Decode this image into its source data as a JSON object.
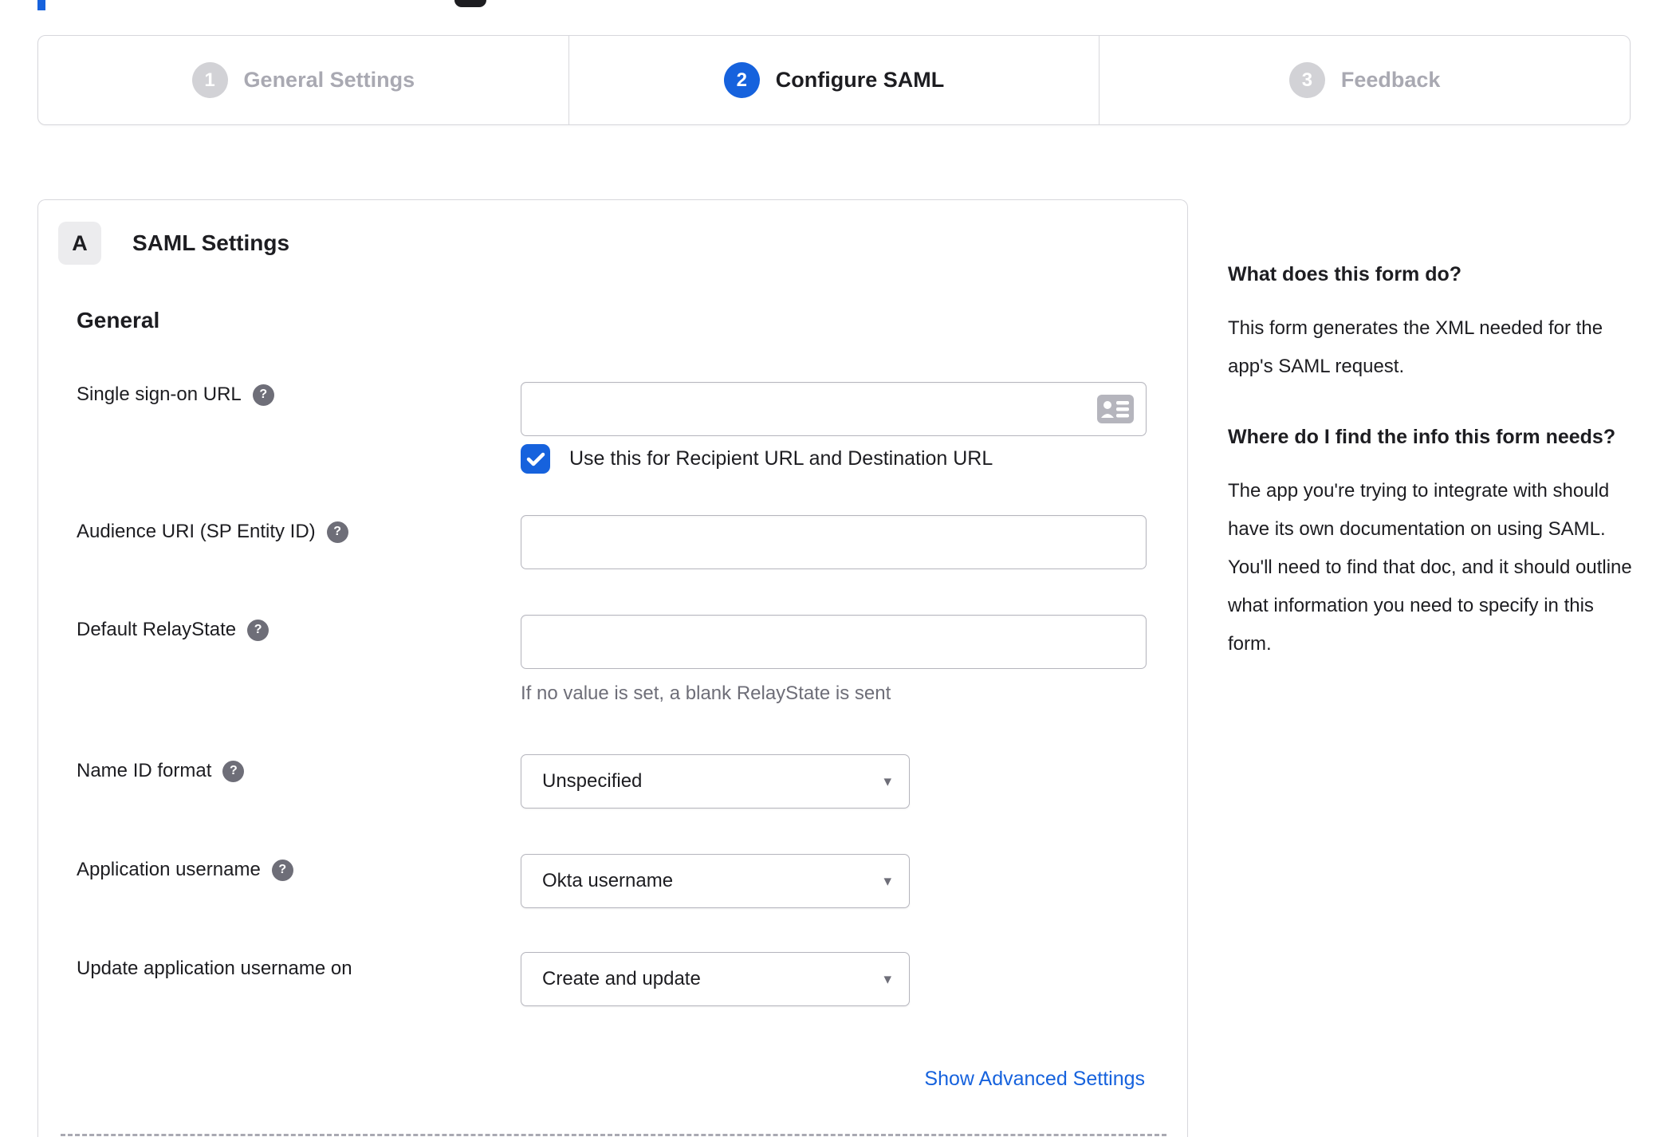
{
  "colors": {
    "accent_blue": "#1662dd",
    "dark_text": "#1d1d21",
    "muted_text": "#6e6e78",
    "border_gray": "#d7d7dc",
    "inactive_step_gray": "#d2d2d6"
  },
  "stepper": {
    "steps": [
      {
        "number": "1",
        "label": "General Settings",
        "state": "inactive"
      },
      {
        "number": "2",
        "label": "Configure SAML",
        "state": "active"
      },
      {
        "number": "3",
        "label": "Feedback",
        "state": "inactive"
      }
    ]
  },
  "panel": {
    "badge": "A",
    "title": "SAML Settings",
    "section_heading": "General",
    "fields": {
      "sso_url": {
        "label": "Single sign-on URL",
        "value": ""
      },
      "sso_checkbox": {
        "label": "Use this for Recipient URL and Destination URL",
        "checked": true
      },
      "audience_uri": {
        "label": "Audience URI (SP Entity ID)",
        "value": ""
      },
      "relay_state": {
        "label": "Default RelayState",
        "value": "",
        "hint": "If no value is set, a blank RelayState is sent"
      },
      "name_id_format": {
        "label": "Name ID format",
        "value": "Unspecified"
      },
      "app_username": {
        "label": "Application username",
        "value": "Okta username"
      },
      "update_username": {
        "label": "Update application username on",
        "value": "Create and update"
      }
    },
    "advanced_link": "Show Advanced Settings"
  },
  "sidebar": {
    "question_1": "What does this form do?",
    "answer_1": "This form generates the XML needed for the app's SAML request.",
    "question_2": "Where do I find the info this form needs?",
    "answer_2": "The app you're trying to integrate with should have its own documentation on using SAML. You'll need to find that doc, and it should outline what information you need to specify in this form."
  },
  "icons": {
    "help": "?",
    "caret": "▾"
  }
}
